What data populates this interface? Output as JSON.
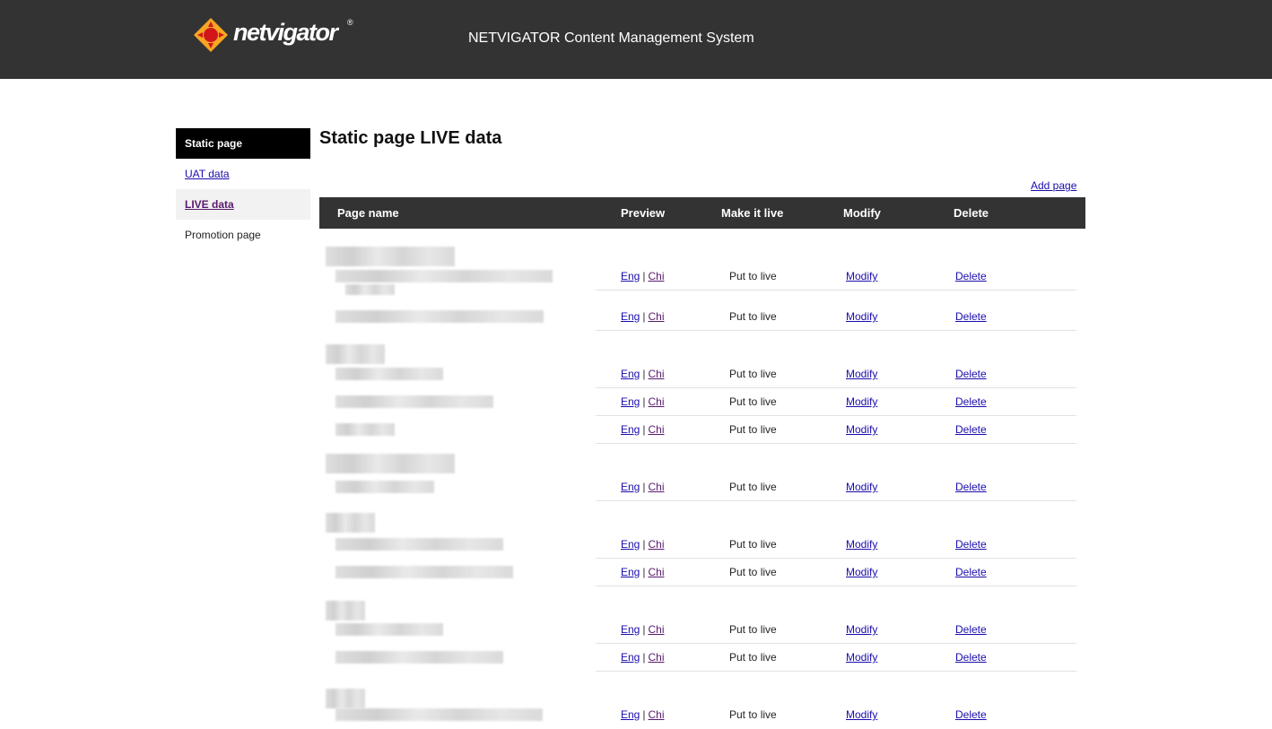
{
  "header": {
    "logo_text": "netvigator",
    "logo_reg": "®",
    "title": "NETVIGATOR Content Management System"
  },
  "sidebar": {
    "items": [
      {
        "label": "Static page"
      },
      {
        "label": "UAT data"
      },
      {
        "label": "LIVE data"
      },
      {
        "label": "Promotion page"
      }
    ]
  },
  "main": {
    "title": "Static page LIVE data",
    "add_page": "Add page",
    "columns": [
      "Page name",
      "Preview",
      "Make it live",
      "Modify",
      "Delete"
    ],
    "row_labels": {
      "eng": "Eng",
      "sep": "|",
      "chi": "Chi",
      "live": "Put to live",
      "modify": "Modify",
      "delete": "Delete"
    }
  },
  "colors": {
    "header_bg": "#333333",
    "link": "#1a0dab",
    "visited_link": "#5a1a6e",
    "logo_orange": "#f5a623",
    "logo_red": "#d0161b"
  }
}
